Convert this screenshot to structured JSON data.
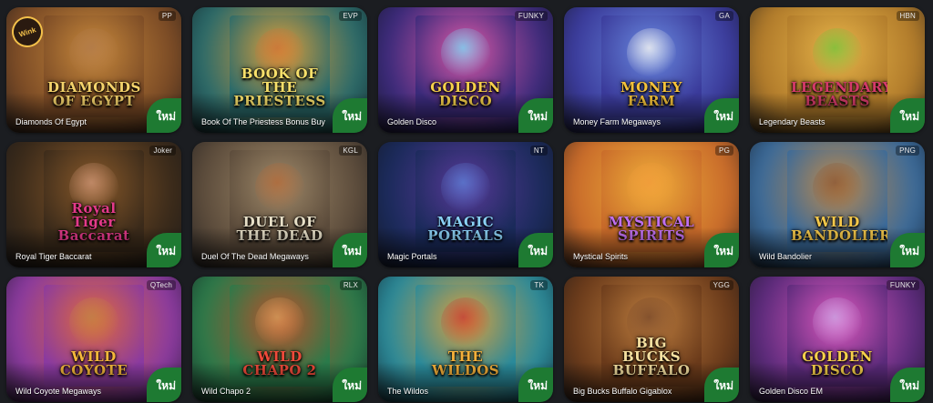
{
  "new_label": "ใหม่",
  "games": [
    {
      "title": "Diamonds Of Egypt",
      "provider": "PP",
      "logo": "DIAMONDS OF EGYPT",
      "bg": "#7a4a25",
      "bg2": "#c98a3c",
      "logo_color": "#f5d36b",
      "fig": "#b07a4a",
      "wink": "Wink"
    },
    {
      "title": "Book Of The Priestess Bonus Buy",
      "provider": "EVP",
      "logo": "BOOK OF THE PRIESTESS",
      "bg": "#2a6a6a",
      "bg2": "#e0a03a",
      "logo_color": "#f7e06b",
      "fig": "#c8743a"
    },
    {
      "title": "Golden Disco",
      "provider": "FUNKY",
      "logo": "GOLDEN DISCO",
      "bg": "#3a2a7a",
      "bg2": "#e05aa8",
      "logo_color": "#f7d04a",
      "fig": "#7ad0f0"
    },
    {
      "title": "Money Farm Megaways",
      "provider": "GA",
      "logo": "MONEY FARM",
      "bg": "#3a3a9a",
      "bg2": "#6a8ae0",
      "logo_color": "#f5c23a",
      "fig": "#f0f0f0"
    },
    {
      "title": "Legendary Beasts",
      "provider": "HBN",
      "logo": "LEGENDARY BEASTS",
      "bg": "#b07a2a",
      "bg2": "#e8b64a",
      "logo_color": "#d43a6a",
      "fig": "#7ac03a"
    },
    {
      "title": "Royal Tiger Baccarat",
      "provider": "Joker",
      "logo": "Royal Tiger Baccarat",
      "bg": "#3a2a1a",
      "bg2": "#8a5a2a",
      "logo_color": "#e33a8a",
      "fig": "#c89070"
    },
    {
      "title": "Duel Of The Dead Megaways",
      "provider": "KGL",
      "logo": "DUEL OF THE DEAD",
      "bg": "#5a4a3a",
      "bg2": "#a08a6a",
      "logo_color": "#e8e0c8",
      "fig": "#b06a3a"
    },
    {
      "title": "Magic Portals",
      "provider": "NT",
      "logo": "MAGIC PORTALS",
      "bg": "#1a2a5a",
      "bg2": "#5a3a9a",
      "logo_color": "#8ad0f5",
      "fig": "#5a7ad0"
    },
    {
      "title": "Mystical Spirits",
      "provider": "PG",
      "logo": "MYSTICAL SPIRITS",
      "bg": "#c86a2a",
      "bg2": "#f0b03a",
      "logo_color": "#c070f0",
      "fig": "#f09a3a"
    },
    {
      "title": "Wild Bandolier",
      "provider": "PNG",
      "logo": "WILD BANDOLIER",
      "bg": "#3a6a9a",
      "bg2": "#c08a4a",
      "logo_color": "#f5c84a",
      "fig": "#8a5a3a"
    },
    {
      "title": "Wild Coyote Megaways",
      "provider": "QTech",
      "logo": "WILD COYOTE",
      "bg": "#8a3aa0",
      "bg2": "#e06a3a",
      "logo_color": "#f5b83a",
      "fig": "#c0804a"
    },
    {
      "title": "Wild Chapo 2",
      "provider": "RLX",
      "logo": "WILD CHAPO 2",
      "bg": "#2a7a4a",
      "bg2": "#c0502a",
      "logo_color": "#f04a3a",
      "fig": "#d09a5a"
    },
    {
      "title": "The Wildos",
      "provider": "TK",
      "logo": "THE WILDOS",
      "bg": "#2a8a9a",
      "bg2": "#e0a03a",
      "logo_color": "#f5b03a",
      "fig": "#c0403a"
    },
    {
      "title": "Big Bucks Buffalo Gigablox",
      "provider": "YGG",
      "logo": "BIG BUCKS BUFFALO",
      "bg": "#6a3a1a",
      "bg2": "#c08040",
      "logo_color": "#f5e0a0",
      "fig": "#7a4a2a"
    },
    {
      "title": "Golden Disco EM",
      "provider": "FUNKY",
      "logo": "GOLDEN DISCO",
      "bg": "#5a2a7a",
      "bg2": "#e05ac0",
      "logo_color": "#f7d04a",
      "fig": "#c8a0e0"
    }
  ]
}
